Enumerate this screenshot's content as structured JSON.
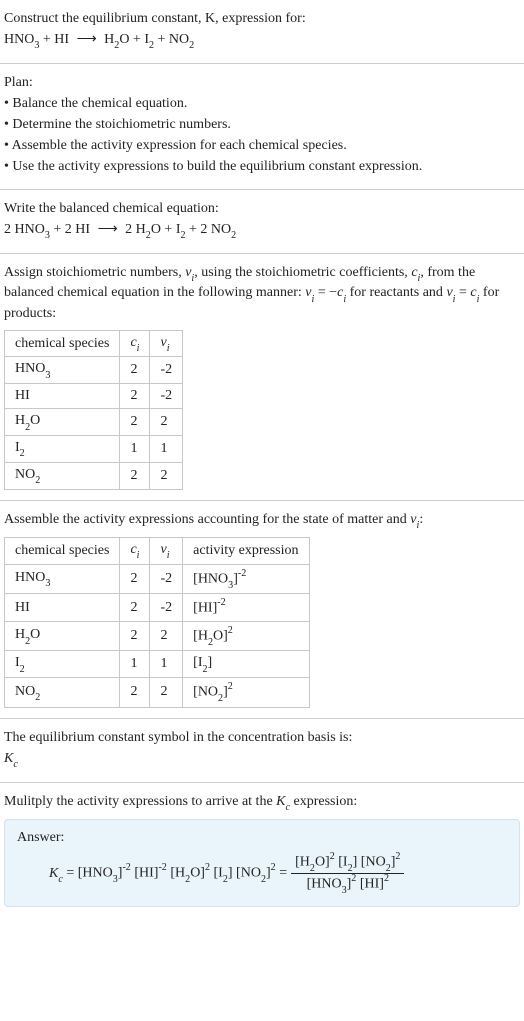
{
  "header": {
    "prompt": "Construct the equilibrium constant, K, expression for:",
    "equation_html": "HNO<span class='sub'>3</span> + HI <span class='arrow'>⟶</span> H<span class='sub'>2</span>O + I<span class='sub'>2</span> + NO<span class='sub'>2</span>"
  },
  "plan": {
    "title": "Plan:",
    "items": [
      "Balance the chemical equation.",
      "Determine the stoichiometric numbers.",
      "Assemble the activity expression for each chemical species.",
      "Use the activity expressions to build the equilibrium constant expression."
    ]
  },
  "balanced": {
    "title": "Write the balanced chemical equation:",
    "equation_html": "2 HNO<span class='sub'>3</span> + 2 HI <span class='arrow'>⟶</span> 2 H<span class='sub'>2</span>O + I<span class='sub'>2</span> + 2 NO<span class='sub'>2</span>"
  },
  "stoich": {
    "intro_html": "Assign stoichiometric numbers, <span class='italic'>ν<span class='sub'>i</span></span>, using the stoichiometric coefficients, <span class='italic'>c<span class='sub'>i</span></span>, from the balanced chemical equation in the following manner: <span class='italic'>ν<span class='sub'>i</span></span> = −<span class='italic'>c<span class='sub'>i</span></span> for reactants and <span class='italic'>ν<span class='sub'>i</span></span> = <span class='italic'>c<span class='sub'>i</span></span> for products:",
    "headers": [
      "chemical species",
      "c_i",
      "ν_i"
    ],
    "header_html": [
      "chemical species",
      "<span class='italic'>c<span class='sub'>i</span></span>",
      "<span class='italic'>ν<span class='sub'>i</span></span>"
    ],
    "rows": [
      {
        "species_html": "HNO<span class='sub'>3</span>",
        "c": "2",
        "v": "-2"
      },
      {
        "species_html": "HI",
        "c": "2",
        "v": "-2"
      },
      {
        "species_html": "H<span class='sub'>2</span>O",
        "c": "2",
        "v": "2"
      },
      {
        "species_html": "I<span class='sub'>2</span>",
        "c": "1",
        "v": "1"
      },
      {
        "species_html": "NO<span class='sub'>2</span>",
        "c": "2",
        "v": "2"
      }
    ]
  },
  "activity": {
    "intro_html": "Assemble the activity expressions accounting for the state of matter and <span class='italic'>ν<span class='sub'>i</span></span>:",
    "headers": [
      "chemical species",
      "c_i",
      "ν_i",
      "activity expression"
    ],
    "header_html": [
      "chemical species",
      "<span class='italic'>c<span class='sub'>i</span></span>",
      "<span class='italic'>ν<span class='sub'>i</span></span>",
      "activity expression"
    ],
    "rows": [
      {
        "species_html": "HNO<span class='sub'>3</span>",
        "c": "2",
        "v": "-2",
        "act_html": "[HNO<span class='sub'>3</span>]<span class='sup'>-2</span>"
      },
      {
        "species_html": "HI",
        "c": "2",
        "v": "-2",
        "act_html": "[HI]<span class='sup'>-2</span>"
      },
      {
        "species_html": "H<span class='sub'>2</span>O",
        "c": "2",
        "v": "2",
        "act_html": "[H<span class='sub'>2</span>O]<span class='sup'>2</span>"
      },
      {
        "species_html": "I<span class='sub'>2</span>",
        "c": "1",
        "v": "1",
        "act_html": "[I<span class='sub'>2</span>]"
      },
      {
        "species_html": "NO<span class='sub'>2</span>",
        "c": "2",
        "v": "2",
        "act_html": "[NO<span class='sub'>2</span>]<span class='sup'>2</span>"
      }
    ]
  },
  "symbol": {
    "line1": "The equilibrium constant symbol in the concentration basis is:",
    "line2_html": "<span class='italic'>K<span class='sub'>c</span></span>"
  },
  "final": {
    "intro_html": "Mulitply the activity expressions to arrive at the <span class='italic'>K<span class='sub'>c</span></span> expression:",
    "answer_label": "Answer:",
    "lhs_html": "<span class='italic'>K<span class='sub'>c</span></span> = [HNO<span class='sub'>3</span>]<span class='sup'>-2</span> [HI]<span class='sup'>-2</span> [H<span class='sub'>2</span>O]<span class='sup'>2</span> [I<span class='sub'>2</span>] [NO<span class='sub'>2</span>]<span class='sup'>2</span> = ",
    "frac_num_html": "[H<span class='sub'>2</span>O]<span class='sup'>2</span> [I<span class='sub'>2</span>] [NO<span class='sub'>2</span>]<span class='sup'>2</span>",
    "frac_den_html": "[HNO<span class='sub'>3</span>]<span class='sup'>2</span> [HI]<span class='sup'>2</span>"
  }
}
